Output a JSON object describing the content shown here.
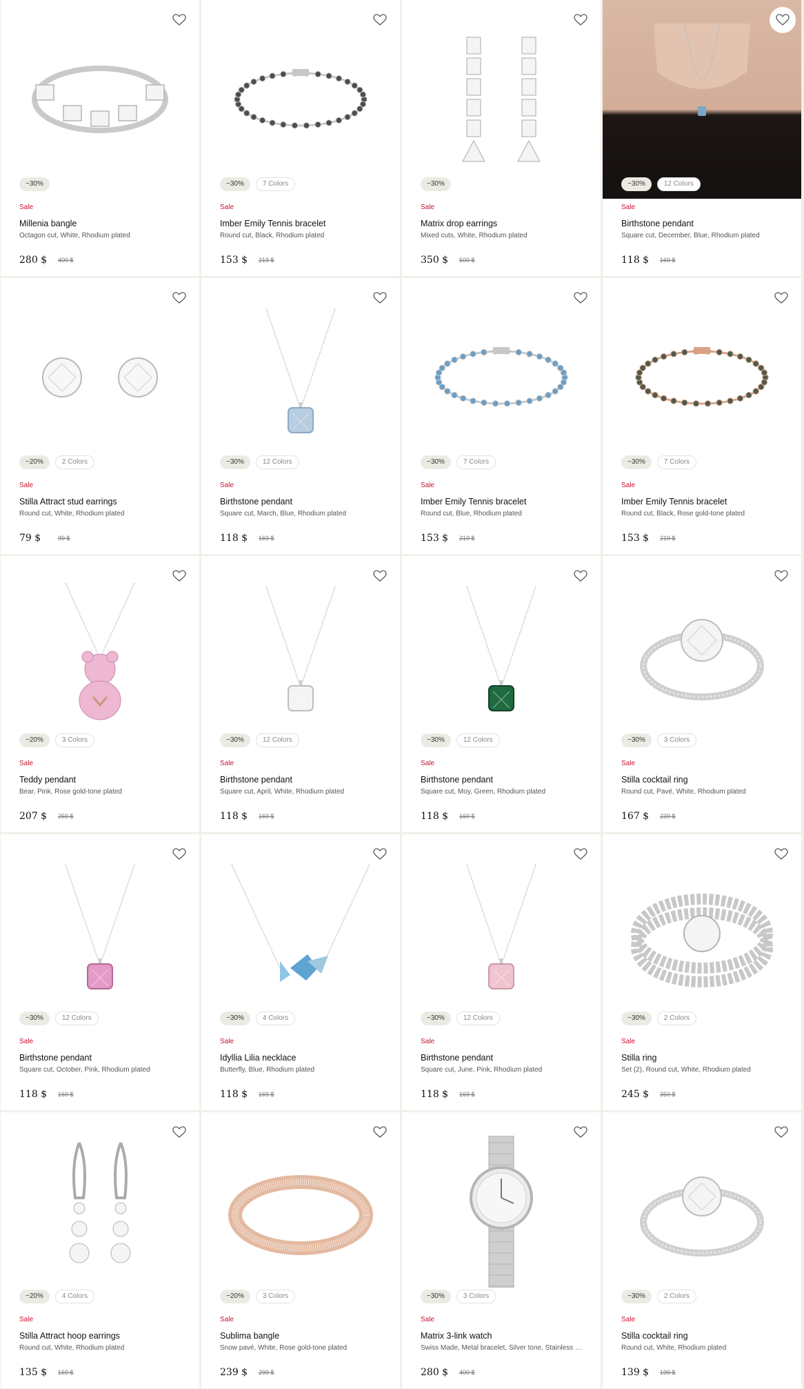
{
  "colors": {
    "sale": "#c8102e",
    "chip_bg": "#ecebe3",
    "divider": "#f2efea"
  },
  "products": [
    {
      "discount": "−30%",
      "colors_label": "",
      "sale": "Sale",
      "name": "Millenia bangle",
      "desc": "Octagon cut, White, Rhodium plated",
      "price": "280 $",
      "old_price": "400 $",
      "image": "bangle-crystal-silver"
    },
    {
      "discount": "−30%",
      "colors_label": "7 Colors",
      "sale": "Sale",
      "name": "Imber Emily Tennis bracelet",
      "desc": "Round cut, Black, Rhodium plated",
      "price": "153 $",
      "old_price": "219 $",
      "image": "tennis-bracelet-black"
    },
    {
      "discount": "−30%",
      "colors_label": "",
      "sale": "Sale",
      "name": "Matrix drop earrings",
      "desc": "Mixed cuts, White, Rhodium plated",
      "price": "350 $",
      "old_price": "500 $",
      "image": "drop-earrings"
    },
    {
      "discount": "−30%",
      "colors_label": "12 Colors",
      "sale": "Sale",
      "name": "Birthstone pendant",
      "desc": "Square cut, December, Blue, Rhodium plated",
      "price": "118 $",
      "old_price": "169 $",
      "image": "model-wearing-pendant"
    },
    {
      "discount": "−20%",
      "colors_label": "2 Colors",
      "sale": "Sale",
      "name": "Stilla Attract stud earrings",
      "desc": "Round cut, White, Rhodium plated",
      "price": "79 $",
      "old_price": "99 $",
      "image": "stud-earrings"
    },
    {
      "discount": "−30%",
      "colors_label": "12 Colors",
      "sale": "Sale",
      "name": "Birthstone pendant",
      "desc": "Square cut, March, Blue, Rhodium plated",
      "price": "118 $",
      "old_price": "169 $",
      "image": "pendant-light-blue"
    },
    {
      "discount": "−30%",
      "colors_label": "7 Colors",
      "sale": "Sale",
      "name": "Imber Emily Tennis bracelet",
      "desc": "Round cut, Blue, Rhodium plated",
      "price": "153 $",
      "old_price": "219 $",
      "image": "tennis-bracelet-blue"
    },
    {
      "discount": "−30%",
      "colors_label": "7 Colors",
      "sale": "Sale",
      "name": "Imber Emily Tennis bracelet",
      "desc": "Round cut, Black, Rose gold-tone plated",
      "price": "153 $",
      "old_price": "219 $",
      "image": "tennis-bracelet-rose"
    },
    {
      "discount": "−20%",
      "colors_label": "3 Colors",
      "sale": "Sale",
      "name": "Teddy pendant",
      "desc": "Bear, Pink, Rose gold-tone plated",
      "price": "207 $",
      "old_price": "259 $",
      "image": "teddy-pendant-pink"
    },
    {
      "discount": "−30%",
      "colors_label": "12 Colors",
      "sale": "Sale",
      "name": "Birthstone pendant",
      "desc": "Square cut, April, White, Rhodium plated",
      "price": "118 $",
      "old_price": "169 $",
      "image": "pendant-white"
    },
    {
      "discount": "−30%",
      "colors_label": "12 Colors",
      "sale": "Sale",
      "name": "Birthstone pendant",
      "desc": "Square cut, Moy, Green, Rhodium plated",
      "price": "118 $",
      "old_price": "169 $",
      "image": "pendant-green"
    },
    {
      "discount": "−30%",
      "colors_label": "3 Colors",
      "sale": "Sale",
      "name": "Stilla cocktail ring",
      "desc": "Round cut, Pavé, White, Rhodium plated",
      "price": "167 $",
      "old_price": "239 $",
      "image": "cocktail-ring-pave"
    },
    {
      "discount": "−30%",
      "colors_label": "12 Colors",
      "sale": "Sale",
      "name": "Birthstone pendant",
      "desc": "Square cut, October, Pink, Rhodium plated",
      "price": "118 $",
      "old_price": "169 $",
      "image": "pendant-pink"
    },
    {
      "discount": "−30%",
      "colors_label": "4 Colors",
      "sale": "Sale",
      "name": "Idyllia Lilia necklace",
      "desc": "Butterfly, Blue, Rhodium plated",
      "price": "118 $",
      "old_price": "169 $",
      "image": "butterfly-necklace"
    },
    {
      "discount": "−30%",
      "colors_label": "12 Colors",
      "sale": "Sale",
      "name": "Birthstone pendant",
      "desc": "Square cut, June, Pink, Rhodium plated",
      "price": "118 $",
      "old_price": "169 $",
      "image": "pendant-light-pink"
    },
    {
      "discount": "−30%",
      "colors_label": "2 Colors",
      "sale": "Sale",
      "name": "Stilla ring",
      "desc": "Set (2), Round cut, White, Rhodium plated",
      "price": "245 $",
      "old_price": "350 $",
      "image": "ring-set"
    },
    {
      "discount": "−20%",
      "colors_label": "4 Colors",
      "sale": "Sale",
      "name": "Stilla Attract hoop earrings",
      "desc": "Round cut, White, Rhodium plated",
      "price": "135 $",
      "old_price": "169 $",
      "image": "hoop-drop-earrings"
    },
    {
      "discount": "−20%",
      "colors_label": "3 Colors",
      "sale": "Sale",
      "name": "Sublima bangle",
      "desc": "Snow pavé, White, Rose gold-tone plated",
      "price": "239 $",
      "old_price": "299 $",
      "image": "rose-bangle"
    },
    {
      "discount": "−30%",
      "colors_label": "3 Colors",
      "sale": "Sale",
      "name": "Matrix 3-link watch",
      "desc": "Swiss Made, Metal bracelet, Silver tone, Stainless steel",
      "price": "280 $",
      "old_price": "400 $",
      "image": "watch-silver"
    },
    {
      "discount": "−30%",
      "colors_label": "2 Colors",
      "sale": "Sale",
      "name": "Stilla cocktail ring",
      "desc": "Round cut, White, Rhodium plated",
      "price": "139 $",
      "old_price": "199 $",
      "image": "solitaire-ring"
    }
  ]
}
